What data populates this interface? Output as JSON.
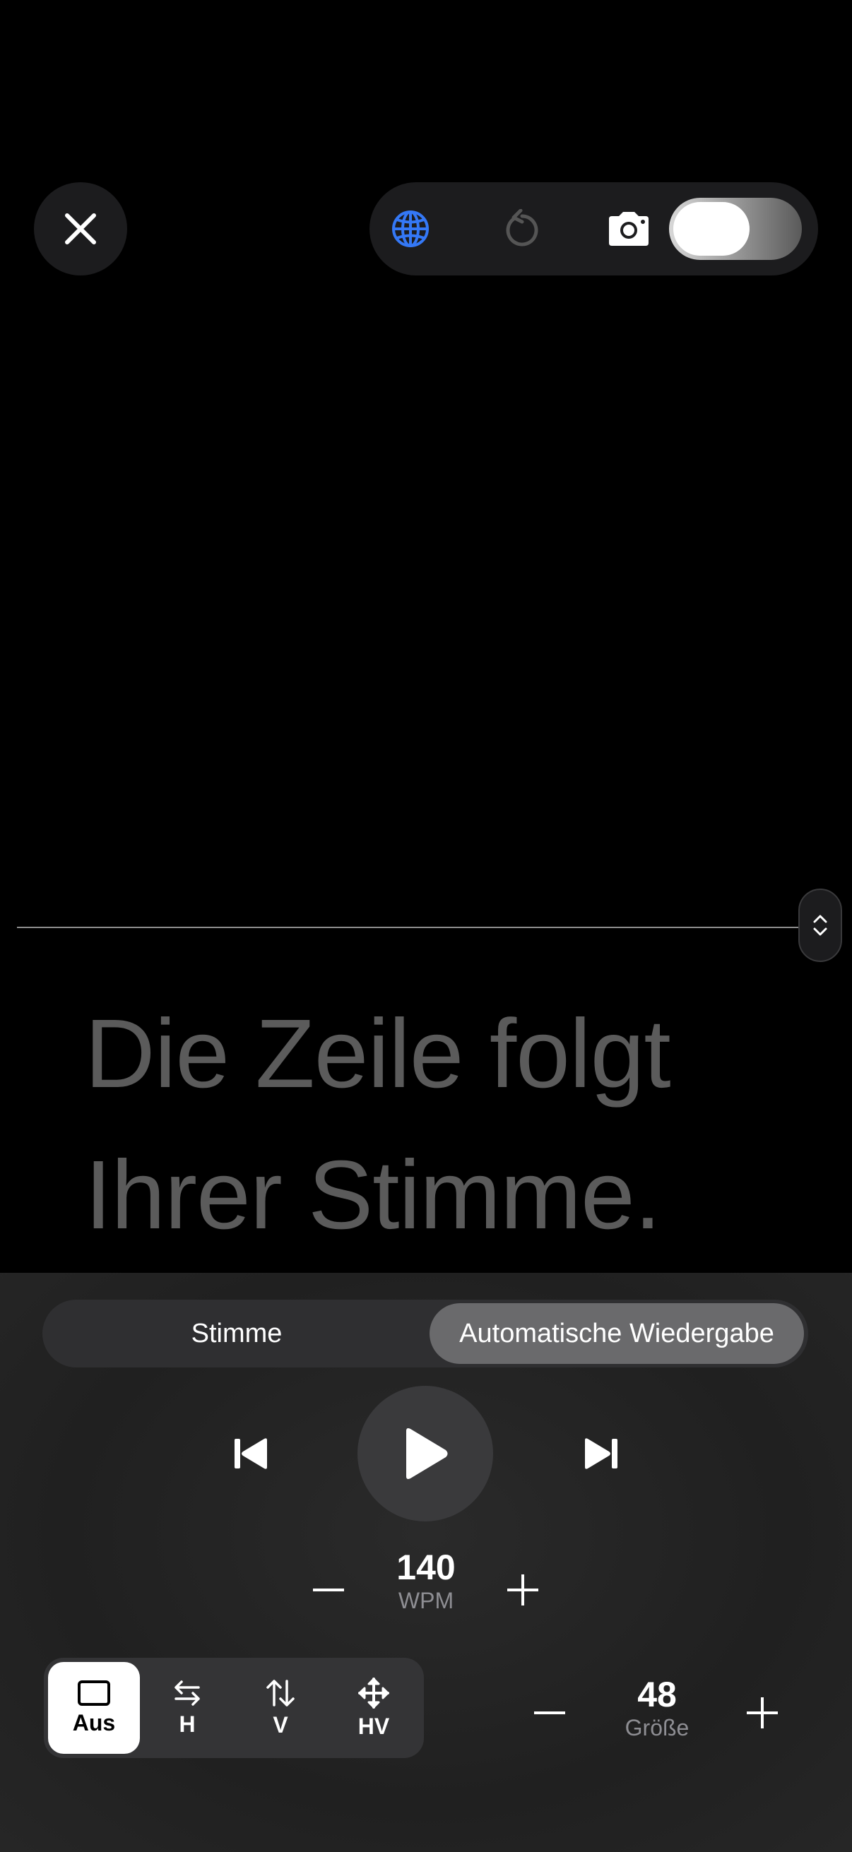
{
  "top": {
    "close_icon": "close-icon",
    "toolbar": {
      "language_icon": "globe-icon",
      "language_icon_color": "#3478f6",
      "reset_icon": "reset-icon",
      "camera_icon": "camera-icon",
      "camera_toggle_on": true
    }
  },
  "script": {
    "lines": [
      "Die Zeile folgt",
      "Ihrer Stimme."
    ],
    "text_color": "#5b5b5b"
  },
  "panel": {
    "tabs": [
      {
        "label": "Stimme",
        "selected": false
      },
      {
        "label": "Automatische Wiedergabe",
        "selected": true
      }
    ],
    "speed": {
      "value": "140",
      "unit": "WPM"
    },
    "scroll_modes": [
      {
        "label": "Aus",
        "icon": "square-icon",
        "selected": true
      },
      {
        "label": "H",
        "icon": "horizontal-arrows-icon",
        "selected": false
      },
      {
        "label": "V",
        "icon": "vertical-arrows-icon",
        "selected": false
      },
      {
        "label": "HV",
        "icon": "move-arrows-icon",
        "selected": false
      }
    ],
    "size": {
      "value": "48",
      "label": "Größe"
    }
  }
}
